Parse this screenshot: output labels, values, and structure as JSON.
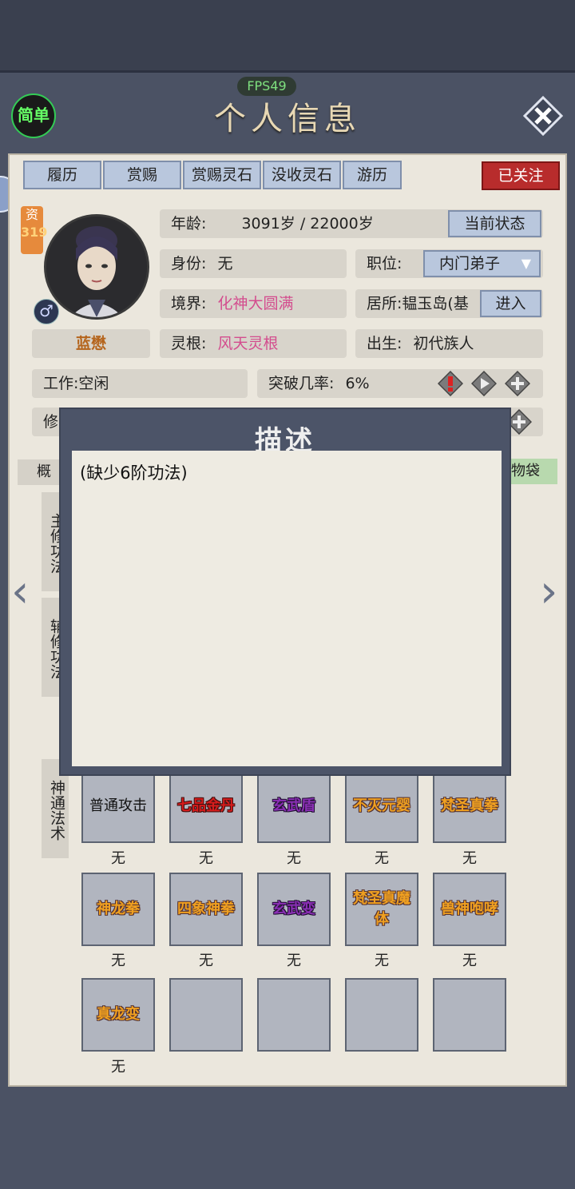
{
  "header": {
    "fps": "FPS49",
    "title": "个人信息",
    "simple_label": "简单"
  },
  "tabs": [
    "履历",
    "赏赐",
    "赏赐灵石",
    "没收灵石",
    "游历"
  ],
  "follow_label": "已关注",
  "resource": {
    "label": "资",
    "value": "319"
  },
  "profile": {
    "name": "蓝懋",
    "age_label": "年龄:",
    "age_value": "3091岁 / 22000岁",
    "status_button": "当前状态",
    "identity_label": "身份:",
    "identity_value": "无",
    "position_label": "职位:",
    "position_value": "内门弟子",
    "realm_label": "境界:",
    "realm_value": "化神大圆满",
    "residence_label": "居所:",
    "residence_value": "韫玉岛(基",
    "enter_button": "进入",
    "root_label": "灵根:",
    "root_value": "风天灵根",
    "birth_label": "出生:",
    "birth_value": "初代族人",
    "work_label": "工作:",
    "work_value": "空闲",
    "breakthrough_label": "突破几率:",
    "breakthrough_value": "6%",
    "cultivation_partial": "修"
  },
  "section_tabs": {
    "left_partial": "概",
    "right_partial": "物袋"
  },
  "categories": {
    "main": "主修功法",
    "aux": "辅修功法",
    "skills": "神通法术"
  },
  "modal": {
    "title": "描述",
    "text": "(缺少6阶功法)"
  },
  "skills": [
    {
      "name": "普通攻击",
      "style": "s-normal",
      "caption": "无"
    },
    {
      "name": "七品金丹",
      "style": "s-red",
      "caption": "无"
    },
    {
      "name": "玄武盾",
      "style": "s-purple",
      "caption": "无"
    },
    {
      "name": "不灭元婴",
      "style": "s-gold",
      "caption": "无"
    },
    {
      "name": "梵圣真拳",
      "style": "s-gold",
      "caption": "无"
    },
    {
      "name": "神龙拳",
      "style": "s-gold",
      "caption": "无"
    },
    {
      "name": "四象神拳",
      "style": "s-gold",
      "caption": "无"
    },
    {
      "name": "玄武变",
      "style": "s-purple",
      "caption": "无"
    },
    {
      "name": "梵圣真魔体",
      "style": "s-gold",
      "caption": "无"
    },
    {
      "name": "兽神咆哮",
      "style": "s-gold",
      "caption": "无"
    },
    {
      "name": "真龙变",
      "style": "s-gold",
      "caption": "无"
    },
    {
      "name": "",
      "style": "s-normal",
      "caption": ""
    },
    {
      "name": "",
      "style": "s-normal",
      "caption": ""
    },
    {
      "name": "",
      "style": "s-normal",
      "caption": ""
    },
    {
      "name": "",
      "style": "s-normal",
      "caption": ""
    }
  ],
  "colors": {
    "accent_pink": "#d34d8e",
    "follow_red": "#b82c2c",
    "tab_blue": "#b9c7dd"
  },
  "icons": [
    "close-icon",
    "gender-male-icon",
    "warning-icon",
    "play-icon",
    "plus-icon",
    "chevron-left-icon",
    "chevron-right-icon"
  ]
}
